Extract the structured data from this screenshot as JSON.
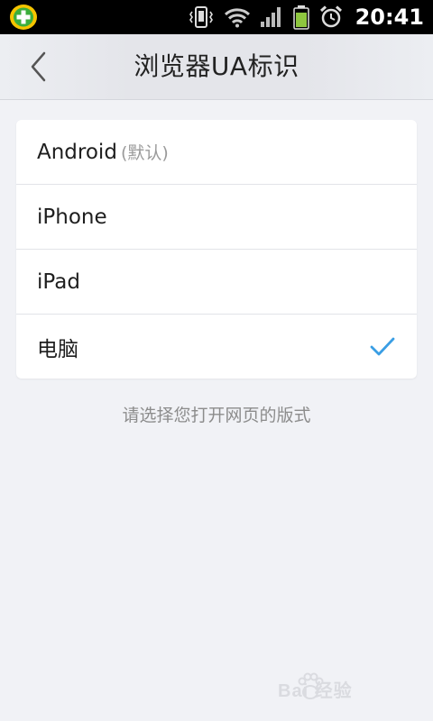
{
  "status_bar": {
    "time": "20:41",
    "icons": [
      "app-shield-icon",
      "vibrate-icon",
      "wifi-icon",
      "signal-icon",
      "battery-icon",
      "alarm-icon"
    ]
  },
  "header": {
    "title": "浏览器UA标识",
    "back_icon": "chevron-left-icon"
  },
  "options": [
    {
      "label": "Android",
      "note": "(默认)",
      "selected": false
    },
    {
      "label": "iPhone",
      "note": "",
      "selected": false
    },
    {
      "label": "iPad",
      "note": "",
      "selected": false
    },
    {
      "label": "电脑",
      "note": "",
      "selected": true
    }
  ],
  "hint": "请选择您打开网页的版式",
  "watermark": {
    "text": "Bai 经验"
  },
  "colors": {
    "accent": "#3a9ee4",
    "background": "#f1f2f6",
    "card": "#ffffff",
    "hint": "#8c8c8c"
  }
}
